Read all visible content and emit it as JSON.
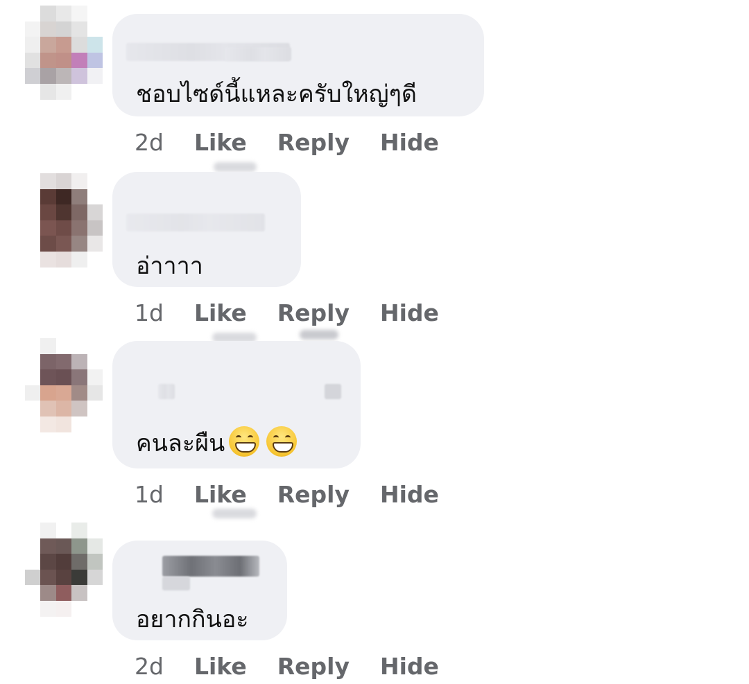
{
  "comments": [
    {
      "text": "ชอบไซด์นี้แหละครับใหญ่ๆดี",
      "time": "2d",
      "like": "Like",
      "reply": "Reply",
      "hide": "Hide"
    },
    {
      "text": "อ่าาาา",
      "time": "1d",
      "like": "Like",
      "reply": "Reply",
      "hide": "Hide"
    },
    {
      "text": "คนละผืน",
      "emoji": [
        "grinning-face-with-smiling-eyes",
        "grinning-face-with-smiling-eyes"
      ],
      "time": "1d",
      "like": "Like",
      "reply": "Reply",
      "hide": "Hide"
    },
    {
      "text": "อยากกินอะ",
      "time": "2d",
      "like": "Like",
      "reply": "Reply",
      "hide": "Hide"
    }
  ],
  "colors": {
    "bubble": "#eff0f4",
    "secondary_text": "#65676b",
    "primary_text": "#111111"
  }
}
